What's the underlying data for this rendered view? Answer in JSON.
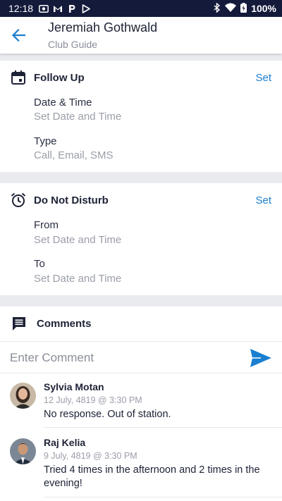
{
  "status_bar": {
    "time": "12:18",
    "icons": [
      "photo-icon",
      "gmail-icon",
      "p-icon",
      "play-icon"
    ],
    "battery": "100%"
  },
  "header": {
    "name": "Jeremiah Gothwald",
    "role": "Club Guide"
  },
  "follow_up": {
    "title": "Follow Up",
    "action": "Set",
    "fields": [
      {
        "label": "Date & Time",
        "value": "Set Date and Time"
      },
      {
        "label": "Type",
        "value": "Call, Email, SMS"
      }
    ]
  },
  "do_not_disturb": {
    "title": "Do Not Disturb",
    "action": "Set",
    "fields": [
      {
        "label": "From",
        "value": "Set Date and Time"
      },
      {
        "label": "To",
        "value": "Set Date and Time"
      }
    ]
  },
  "comments": {
    "title": "Comments",
    "input_placeholder": "Enter Comment",
    "items": [
      {
        "name": "Sylvia Motan",
        "time": "12 July, 4819 @ 3:30 PM",
        "text": "No response. Out of station."
      },
      {
        "name": "Raj Kelia",
        "time": "9 July, 4819 @ 3:30 PM",
        "text": "Tried 4 times in the afternoon and 2 times in the evening!"
      }
    ]
  },
  "colors": {
    "accent": "#1a7fd1",
    "status_bar": "#141a3a",
    "separator": "#e9ebef"
  }
}
